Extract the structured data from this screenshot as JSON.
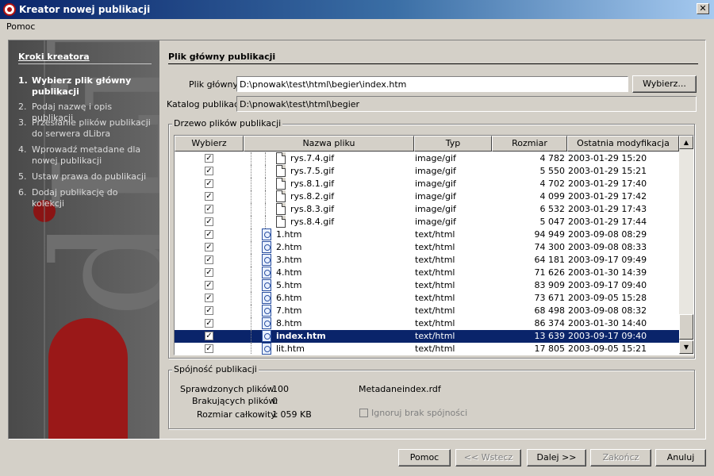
{
  "window": {
    "title": "Kreator nowej publikacji"
  },
  "menu": {
    "help": "Pomoc"
  },
  "sidebar": {
    "title": "Kroki kreatora",
    "steps": [
      {
        "num": "1.",
        "label": "Wybierz plik główny publikacji",
        "active": true
      },
      {
        "num": "2.",
        "label": "Podaj nazwę i opis publikacji",
        "active": false
      },
      {
        "num": "3.",
        "label": "Przesłanie plików publikacji do serwera dLibra",
        "active": false
      },
      {
        "num": "4.",
        "label": "Wprowadź metadane dla nowej publikacji",
        "active": false
      },
      {
        "num": "5.",
        "label": "Ustaw prawa do publikacji",
        "active": false
      },
      {
        "num": "6.",
        "label": "Dodaj publikację do kolekcji",
        "active": false
      }
    ]
  },
  "main": {
    "section_title": "Plik główny publikacji",
    "main_file_label": "Plik główny",
    "main_file_value": "D:\\pnowak\\test\\html\\begier\\index.htm",
    "choose_button": "Wybierz...",
    "catalog_label": "Katalog publikacji",
    "catalog_value": "D:\\pnowak\\test\\html\\begier"
  },
  "tree": {
    "group_title": "Drzewo plików publikacji",
    "columns": [
      "Wybierz",
      "Nazwa pliku",
      "Typ",
      "Rozmiar",
      "Ostatnia modyfikacja"
    ],
    "rows": [
      {
        "checked": true,
        "name": "rys.7.4.gif",
        "kind": "gif",
        "type": "image/gif",
        "size": "4 782",
        "modified": "2003-01-29 15:20"
      },
      {
        "checked": true,
        "name": "rys.7.5.gif",
        "kind": "gif",
        "type": "image/gif",
        "size": "5 550",
        "modified": "2003-01-29 15:21"
      },
      {
        "checked": true,
        "name": "rys.8.1.gif",
        "kind": "gif",
        "type": "image/gif",
        "size": "4 702",
        "modified": "2003-01-29 17:40"
      },
      {
        "checked": true,
        "name": "rys.8.2.gif",
        "kind": "gif",
        "type": "image/gif",
        "size": "4 099",
        "modified": "2003-01-29 17:42"
      },
      {
        "checked": true,
        "name": "rys.8.3.gif",
        "kind": "gif",
        "type": "image/gif",
        "size": "6 532",
        "modified": "2003-01-29 17:43"
      },
      {
        "checked": true,
        "name": "rys.8.4.gif",
        "kind": "gif",
        "type": "image/gif",
        "size": "5 047",
        "modified": "2003-01-29 17:44"
      },
      {
        "checked": true,
        "name": "1.htm",
        "kind": "htm",
        "type": "text/html",
        "size": "94 949",
        "modified": "2003-09-08 08:29"
      },
      {
        "checked": true,
        "name": "2.htm",
        "kind": "htm",
        "type": "text/html",
        "size": "74 300",
        "modified": "2003-09-08 08:33"
      },
      {
        "checked": true,
        "name": "3.htm",
        "kind": "htm",
        "type": "text/html",
        "size": "64 181",
        "modified": "2003-09-17 09:49"
      },
      {
        "checked": true,
        "name": "4.htm",
        "kind": "htm",
        "type": "text/html",
        "size": "71 626",
        "modified": "2003-01-30 14:39"
      },
      {
        "checked": true,
        "name": "5.htm",
        "kind": "htm",
        "type": "text/html",
        "size": "83 909",
        "modified": "2003-09-17 09:40"
      },
      {
        "checked": true,
        "name": "6.htm",
        "kind": "htm",
        "type": "text/html",
        "size": "73 671",
        "modified": "2003-09-05 15:28"
      },
      {
        "checked": true,
        "name": "7.htm",
        "kind": "htm",
        "type": "text/html",
        "size": "68 498",
        "modified": "2003-09-08 08:32"
      },
      {
        "checked": true,
        "name": "8.htm",
        "kind": "htm",
        "type": "text/html",
        "size": "86 374",
        "modified": "2003-01-30 14:40"
      },
      {
        "checked": true,
        "name": "index.htm",
        "kind": "htm",
        "type": "text/html",
        "size": "13 639",
        "modified": "2003-09-17 09:40",
        "selected": true
      },
      {
        "checked": true,
        "name": "lit.htm",
        "kind": "htm",
        "type": "text/html",
        "size": "17 805",
        "modified": "2003-09-05 15:21"
      }
    ]
  },
  "consistency": {
    "group_title": "Spójność publikacji",
    "checked_label": "Sprawdzonych plików:",
    "checked_value": "100",
    "missing_label": "Brakujących plików:",
    "missing_value": "0",
    "size_label": "Rozmiar całkowity:",
    "size_value": "1 059 KB",
    "metadata_label": "Metadane:",
    "metadata_value": "index.rdf",
    "ignore_label": "Ignoruj brak spójności"
  },
  "footer": {
    "help": "Pomoc",
    "back": "<< Wstecz",
    "next": "Dalej >>",
    "finish": "Zakończ",
    "cancel": "Anuluj"
  }
}
